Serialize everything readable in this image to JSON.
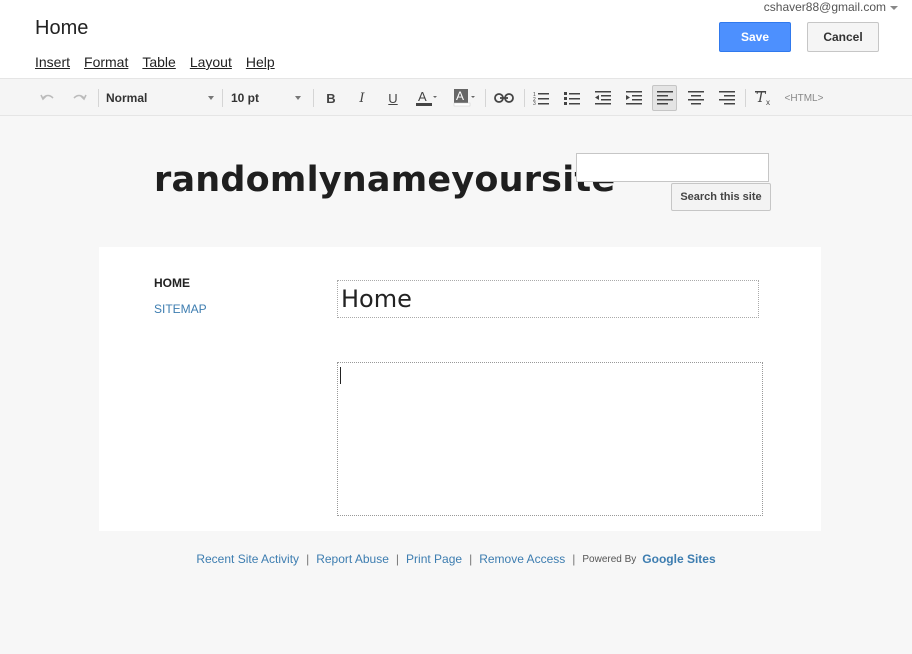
{
  "account": {
    "email": "cshaver88@gmail.com"
  },
  "editor": {
    "title": "Home",
    "menu": [
      {
        "label": "Insert"
      },
      {
        "label": "Format"
      },
      {
        "label": "Table"
      },
      {
        "label": "Layout"
      },
      {
        "label": "Help"
      }
    ],
    "save_label": "Save",
    "cancel_label": "Cancel"
  },
  "toolbar": {
    "style_value": "Normal",
    "size_value": "10 pt",
    "bold_label": "B",
    "italic_label": "I",
    "underline_label": "U",
    "html_label": "<HTML>",
    "icons": [
      "undo-icon",
      "redo-icon",
      "bold-icon",
      "italic-icon",
      "underline-icon",
      "text-color-icon",
      "highlight-color-icon",
      "link-icon",
      "numbered-list-icon",
      "bulleted-list-icon",
      "outdent-icon",
      "indent-icon",
      "align-left-icon",
      "align-center-icon",
      "align-right-icon",
      "clear-formatting-icon"
    ]
  },
  "site": {
    "name": "randomlynameyoursite",
    "search_button": "Search this site",
    "nav": [
      {
        "label": "HOME"
      },
      {
        "label": "SITEMAP"
      }
    ],
    "page_heading": "Home"
  },
  "footer": {
    "links": [
      {
        "label": "Recent Site Activity"
      },
      {
        "label": "Report Abuse"
      },
      {
        "label": "Print Page"
      },
      {
        "label": "Remove Access"
      }
    ],
    "powered_by": "Powered By",
    "brand": "Google Sites"
  }
}
